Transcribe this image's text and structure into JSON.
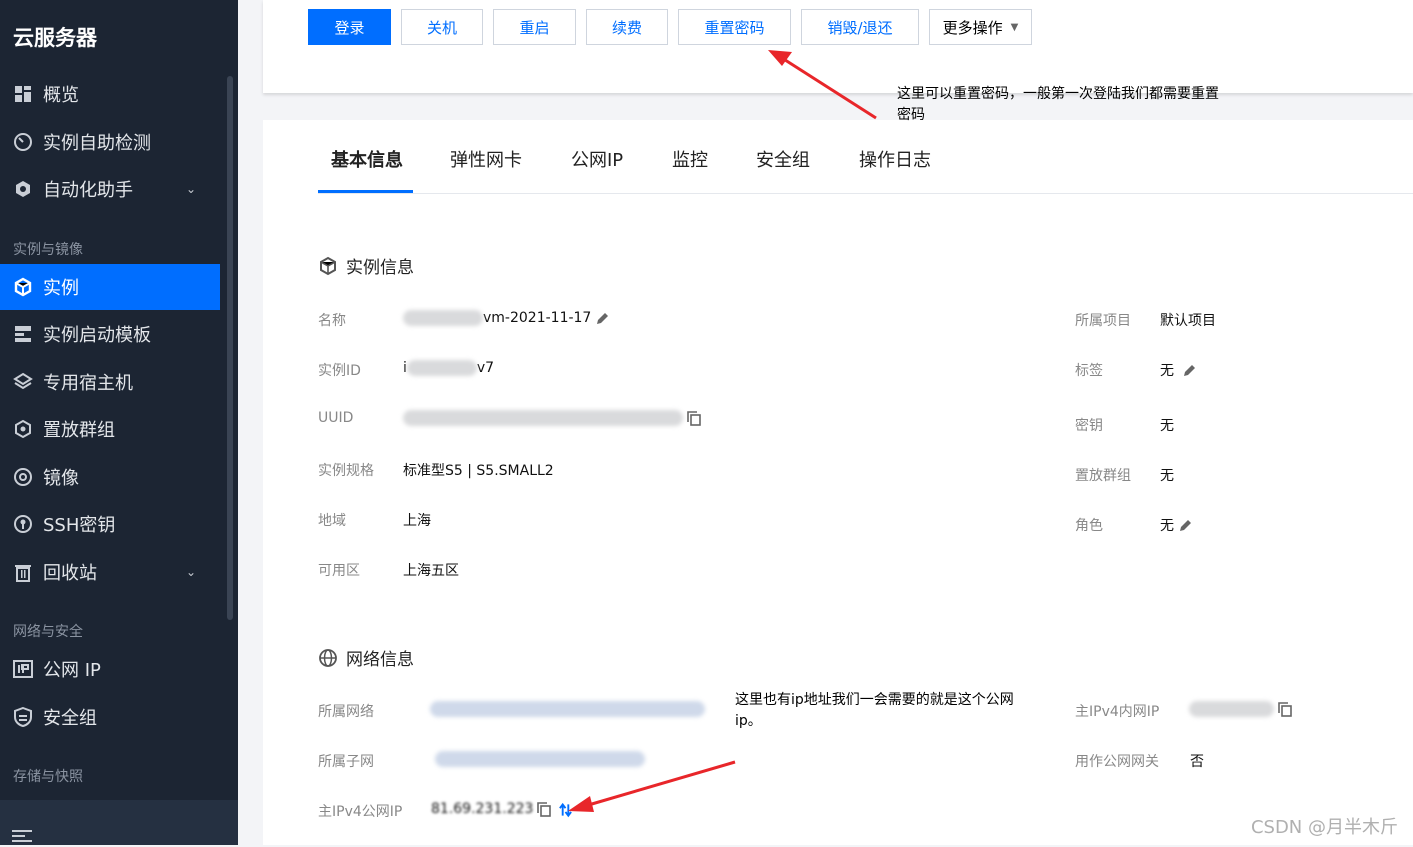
{
  "sidebar": {
    "title": "云服务器",
    "items": [
      {
        "label": "概览",
        "icon": "dashboard-icon"
      },
      {
        "label": "实例自助检测",
        "icon": "gauge-icon"
      },
      {
        "label": "自动化助手",
        "icon": "robot-icon"
      },
      {
        "label": "实例",
        "icon": "cube-icon"
      },
      {
        "label": "实例启动模板",
        "icon": "template-icon"
      },
      {
        "label": "专用宿主机",
        "icon": "layers-icon"
      },
      {
        "label": "置放群组",
        "icon": "hexagon-icon"
      },
      {
        "label": "镜像",
        "icon": "disc-icon"
      },
      {
        "label": "SSH密钥",
        "icon": "key-icon"
      },
      {
        "label": "回收站",
        "icon": "trash-icon"
      },
      {
        "label": "公网 IP",
        "icon": "ip-icon"
      },
      {
        "label": "安全组",
        "icon": "shield-icon"
      }
    ],
    "groups": [
      "实例与镜像",
      "网络与安全",
      "存储与快照"
    ]
  },
  "actions": {
    "login": "登录",
    "shutdown": "关机",
    "restart": "重启",
    "renew": "续费",
    "reset_password": "重置密码",
    "destroy": "销毁/退还",
    "more": "更多操作"
  },
  "tabs": [
    "基本信息",
    "弹性网卡",
    "公网IP",
    "监控",
    "安全组",
    "操作日志"
  ],
  "instance_info": {
    "title": "实例信息",
    "name_label": "名称",
    "name_value": "vm-2021-11-17",
    "id_label": "实例ID",
    "id_value": "i",
    "id_suffix": "v7",
    "uuid_label": "UUID",
    "spec_label": "实例规格",
    "spec_value": "标准型S5 | S5.SMALL2",
    "region_label": "地域",
    "region_value": "上海",
    "zone_label": "可用区",
    "zone_value": "上海五区",
    "project_label": "所属项目",
    "project_value": "默认项目",
    "tag_label": "标签",
    "tag_value": "无",
    "key_label": "密钥",
    "key_value": "无",
    "placement_label": "置放群组",
    "placement_value": "无",
    "role_label": "角色",
    "role_value": "无"
  },
  "network_info": {
    "title": "网络信息",
    "vpc_label": "所属网络",
    "subnet_label": "所属子网",
    "public_ip_label": "主IPv4公网IP",
    "public_ip_value": "81.69.231.223",
    "private_ip_label": "主IPv4内网IP",
    "gateway_label": "用作公网网关",
    "gateway_value": "否"
  },
  "annotations": {
    "reset_note": "这里可以重置密码，一般第一次登陆我们都需要重置密码",
    "ip_note": "这里也有ip地址我们一会需要的就是这个公网ip。"
  },
  "watermark": "CSDN @月半木斤",
  "colors": {
    "accent": "#006eff",
    "sidebar": "#1c2533",
    "arrow": "#e8262a"
  }
}
